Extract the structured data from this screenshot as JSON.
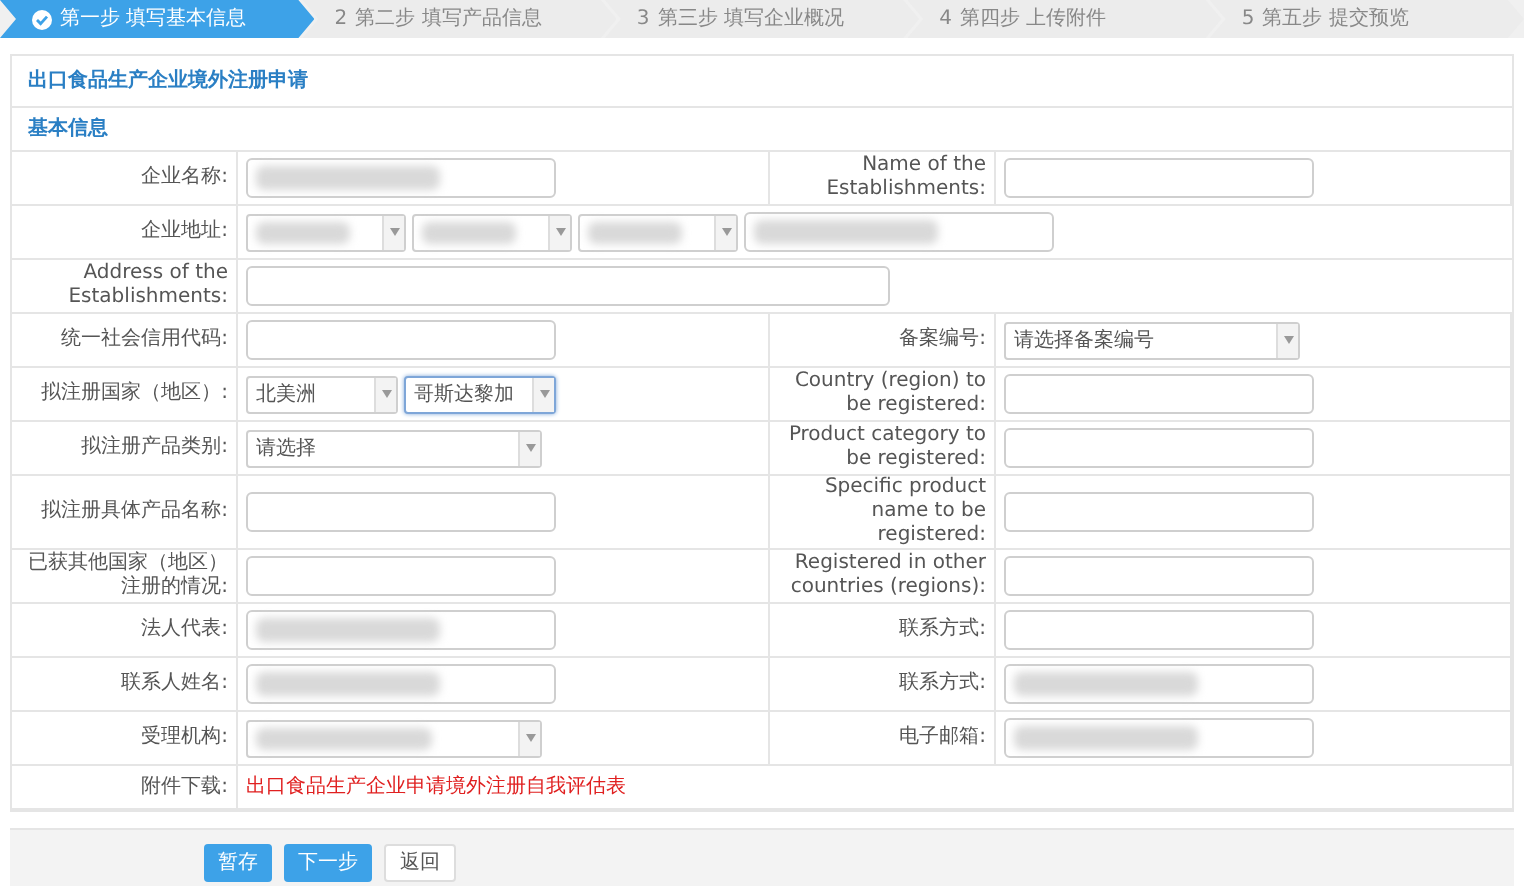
{
  "steps": [
    {
      "label": "第一步 填写基本信息",
      "selected": true
    },
    {
      "number": "2",
      "label": "第二步 填写产品信息",
      "selected": false
    },
    {
      "number": "3",
      "label": "第三步 填写企业概况",
      "selected": false
    },
    {
      "number": "4",
      "label": "第四步 上传附件",
      "selected": false
    },
    {
      "number": "5",
      "label": "第五步 提交预览",
      "selected": false
    }
  ],
  "form": {
    "title": "出口食品生产企业境外注册申请",
    "section": "基本信息",
    "rows": [
      {
        "cells": [
          {
            "label": "企业名称:",
            "fields": [
              {
                "kind": "input",
                "redacted": true
              }
            ]
          },
          {
            "label": "Name of the Establishments:",
            "fields": [
              {
                "kind": "input",
                "redacted": false
              }
            ]
          }
        ]
      },
      {
        "cells": [
          {
            "label": "企业地址:",
            "fields": [
              {
                "kind": "select",
                "redacted": true,
                "focused": false
              },
              {
                "kind": "select",
                "redacted": true,
                "focused": false
              },
              {
                "kind": "select",
                "redacted": true,
                "focused": false
              },
              {
                "kind": "input",
                "redacted": true
              }
            ]
          }
        ]
      },
      {
        "cells": [
          {
            "label": "Address of the Establishments:",
            "fields": [
              {
                "kind": "wide-input",
                "redacted": false
              }
            ]
          }
        ]
      },
      {
        "cells": [
          {
            "label": "统一社会信用代码:",
            "fields": [
              {
                "kind": "input",
                "redacted": false
              }
            ]
          },
          {
            "label": "备案编号:",
            "fields": [
              {
                "kind": "select",
                "value": "请选择备案编号",
                "redacted": false,
                "focused": false
              }
            ]
          }
        ]
      },
      {
        "cells": [
          {
            "label": "拟注册国家（地区）:",
            "fields": [
              {
                "kind": "select",
                "value": "北美洲",
                "redacted": false,
                "focused": false
              },
              {
                "kind": "select",
                "value": "哥斯达黎加",
                "redacted": false,
                "focused": true
              }
            ]
          },
          {
            "label": "Country (region) to be registered:",
            "fields": [
              {
                "kind": "input",
                "redacted": false
              }
            ]
          }
        ]
      },
      {
        "cells": [
          {
            "label": "拟注册产品类别:",
            "fields": [
              {
                "kind": "select",
                "value": "请选择",
                "redacted": false,
                "focused": false
              }
            ]
          },
          {
            "label": "Product category to be registered:",
            "fields": [
              {
                "kind": "input",
                "redacted": false
              }
            ]
          }
        ]
      },
      {
        "cells": [
          {
            "label": "拟注册具体产品名称:",
            "fields": [
              {
                "kind": "input",
                "redacted": false
              }
            ]
          },
          {
            "label": "Specific product name to be registered:",
            "fields": [
              {
                "kind": "input",
                "redacted": false
              }
            ]
          }
        ]
      },
      {
        "cells": [
          {
            "label": "已获其他国家（地区）注册的情况:",
            "fields": [
              {
                "kind": "input",
                "redacted": false
              }
            ]
          },
          {
            "label": "Registered in other countries (regions):",
            "fields": [
              {
                "kind": "input",
                "redacted": false
              }
            ]
          }
        ]
      },
      {
        "cells": [
          {
            "label": "法人代表:",
            "fields": [
              {
                "kind": "input",
                "redacted": true
              }
            ]
          },
          {
            "label": "联系方式:",
            "fields": [
              {
                "kind": "input",
                "redacted": false
              }
            ]
          }
        ]
      },
      {
        "cells": [
          {
            "label": "联系人姓名:",
            "fields": [
              {
                "kind": "input",
                "redacted": true
              }
            ]
          },
          {
            "label": "联系方式:",
            "fields": [
              {
                "kind": "input",
                "redacted": true
              }
            ]
          }
        ]
      },
      {
        "cells": [
          {
            "label": "受理机构:",
            "fields": [
              {
                "kind": "select",
                "redacted": true,
                "focused": false
              }
            ]
          },
          {
            "label": "电子邮箱:",
            "fields": [
              {
                "kind": "input",
                "redacted": true
              }
            ]
          }
        ]
      },
      {
        "cells": [
          {
            "label": "附件下载:",
            "fields": [
              {
                "kind": "link",
                "value": "出口食品生产企业申请境外注册自我评估表"
              }
            ]
          }
        ]
      }
    ]
  },
  "buttons": [
    {
      "label": "暂存",
      "kind": "primary"
    },
    {
      "label": "下一步",
      "kind": "primary"
    },
    {
      "label": "返回",
      "kind": "plain"
    }
  ]
}
